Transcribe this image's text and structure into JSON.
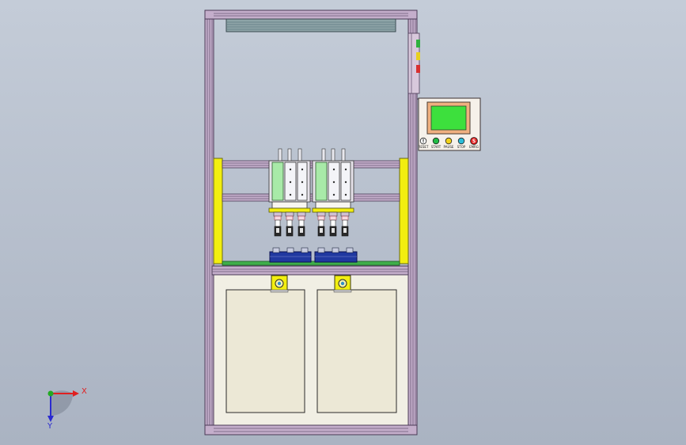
{
  "panel": {
    "buttons": [
      {
        "label": "RESET",
        "color": "#ffffff",
        "glyph": "!"
      },
      {
        "label": "START",
        "color": "#22bb44",
        "glyph": ""
      },
      {
        "label": "PAUSE",
        "color": "#f2d21a",
        "glyph": ""
      },
      {
        "label": "STOP",
        "color": "#2bbcd8",
        "glyph": ""
      },
      {
        "label": "EMRG",
        "color": "#e02020",
        "glyph": "S"
      }
    ]
  },
  "axes": {
    "x_label": "X",
    "y_label": "Y",
    "x_color": "#e02020",
    "y_color": "#2a2ad0",
    "origin_color": "#22aa22"
  },
  "colors": {
    "frame": "#c0a9c8",
    "frame_dark": "#5a4a66",
    "screen": "#3de03d",
    "yellow": "#f2ee10",
    "cylinder": "#a8eaa8",
    "fixture": "#2038a0",
    "plate": "#3fae4a",
    "door": "#e8e4d2"
  }
}
